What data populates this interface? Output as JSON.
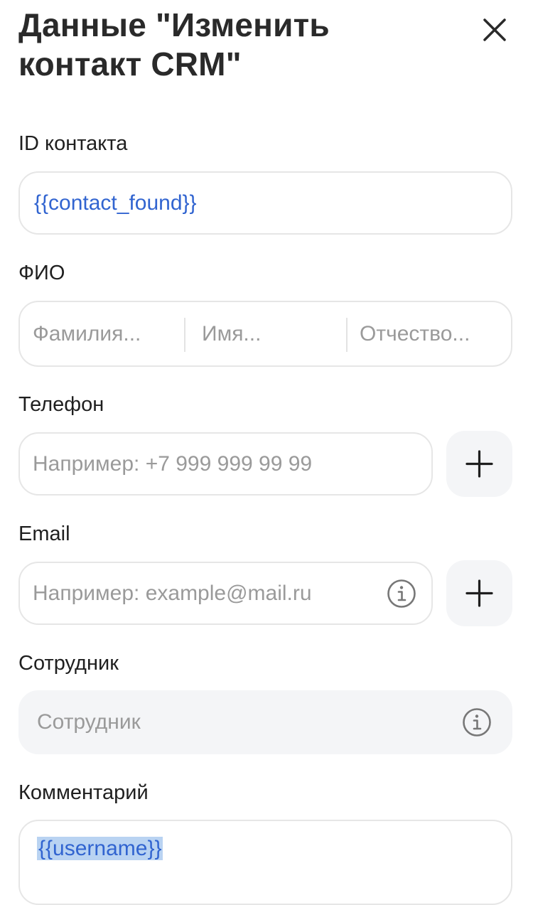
{
  "dialog": {
    "title": "Данные \"Изменить контакт CRM\""
  },
  "fields": {
    "contact_id": {
      "label": "ID контакта",
      "value": "{{contact_found}}"
    },
    "fio": {
      "label": "ФИО",
      "last_name_placeholder": "Фамилия...",
      "first_name_placeholder": "Имя...",
      "middle_name_placeholder": "Отчество..."
    },
    "phone": {
      "label": "Телефон",
      "placeholder": "Например: +7 999 999 99 99"
    },
    "email": {
      "label": "Email",
      "placeholder": "Например: example@mail.ru"
    },
    "employee": {
      "label": "Сотрудник",
      "placeholder": "Сотрудник"
    },
    "comment": {
      "label": "Комментарий",
      "value": "{{username}}"
    }
  },
  "icons": {
    "close": "close-icon",
    "add": "plus-icon",
    "info": "info-icon"
  },
  "colors": {
    "variable_text": "#3164d0",
    "selection_highlight": "#b9d3f2",
    "field_border": "#e6e6e6",
    "button_background": "#f4f5f7"
  }
}
